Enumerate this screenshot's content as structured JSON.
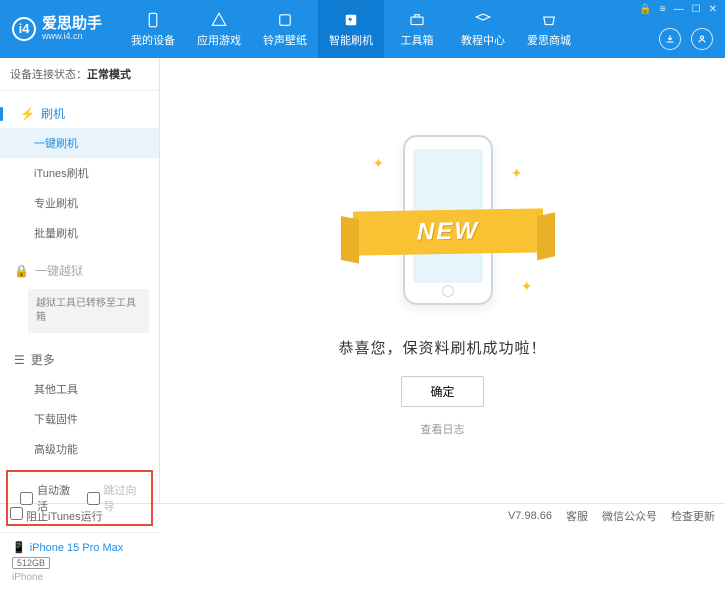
{
  "header": {
    "app_name": "爱思助手",
    "app_url": "www.i4.cn",
    "logo_letter": "i4",
    "nav": [
      {
        "label": "我的设备"
      },
      {
        "label": "应用游戏"
      },
      {
        "label": "铃声壁纸"
      },
      {
        "label": "智能刷机"
      },
      {
        "label": "工具箱"
      },
      {
        "label": "教程中心"
      },
      {
        "label": "爱思商城"
      }
    ]
  },
  "sidebar": {
    "status_label": "设备连接状态：",
    "status_value": "正常模式",
    "section_flash": "刷机",
    "items_flash": [
      "一键刷机",
      "iTunes刷机",
      "专业刷机",
      "批量刷机"
    ],
    "section_jailbreak": "一键越狱",
    "jailbreak_note": "越狱工具已转移至工具箱",
    "section_more": "更多",
    "items_more": [
      "其他工具",
      "下载固件",
      "高级功能"
    ],
    "checkbox1": "自动激活",
    "checkbox2": "跳过向导",
    "device_name": "iPhone 15 Pro Max",
    "device_storage": "512GB",
    "device_type": "iPhone"
  },
  "main": {
    "ribbon": "NEW",
    "success": "恭喜您，保资料刷机成功啦！",
    "ok": "确定",
    "view_log": "查看日志"
  },
  "footer": {
    "block_itunes": "阻止iTunes运行",
    "version": "V7.98.66",
    "links": [
      "客服",
      "微信公众号",
      "检查更新"
    ]
  }
}
